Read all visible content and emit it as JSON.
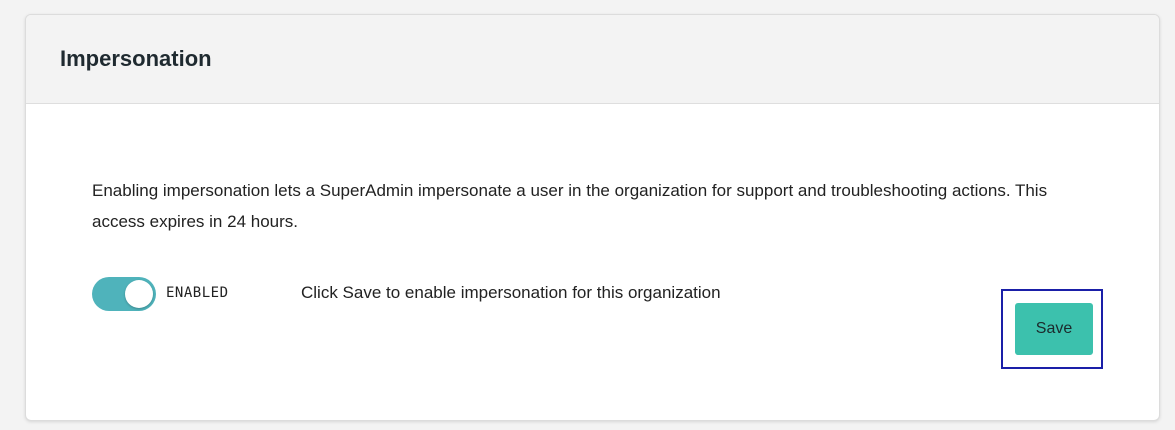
{
  "panel": {
    "title": "Impersonation",
    "description": "Enabling impersonation lets a SuperAdmin impersonate a user in the organization for support and troubleshooting actions. This access expires in 24 hours.",
    "toggle": {
      "label": "ENABLED",
      "state": "on",
      "color": "#4fb3bb"
    },
    "hint": "Click Save to enable impersonation for this organization",
    "save_label": "Save",
    "save_color": "#3cc1ad",
    "highlight_color": "#1a1fa8"
  }
}
